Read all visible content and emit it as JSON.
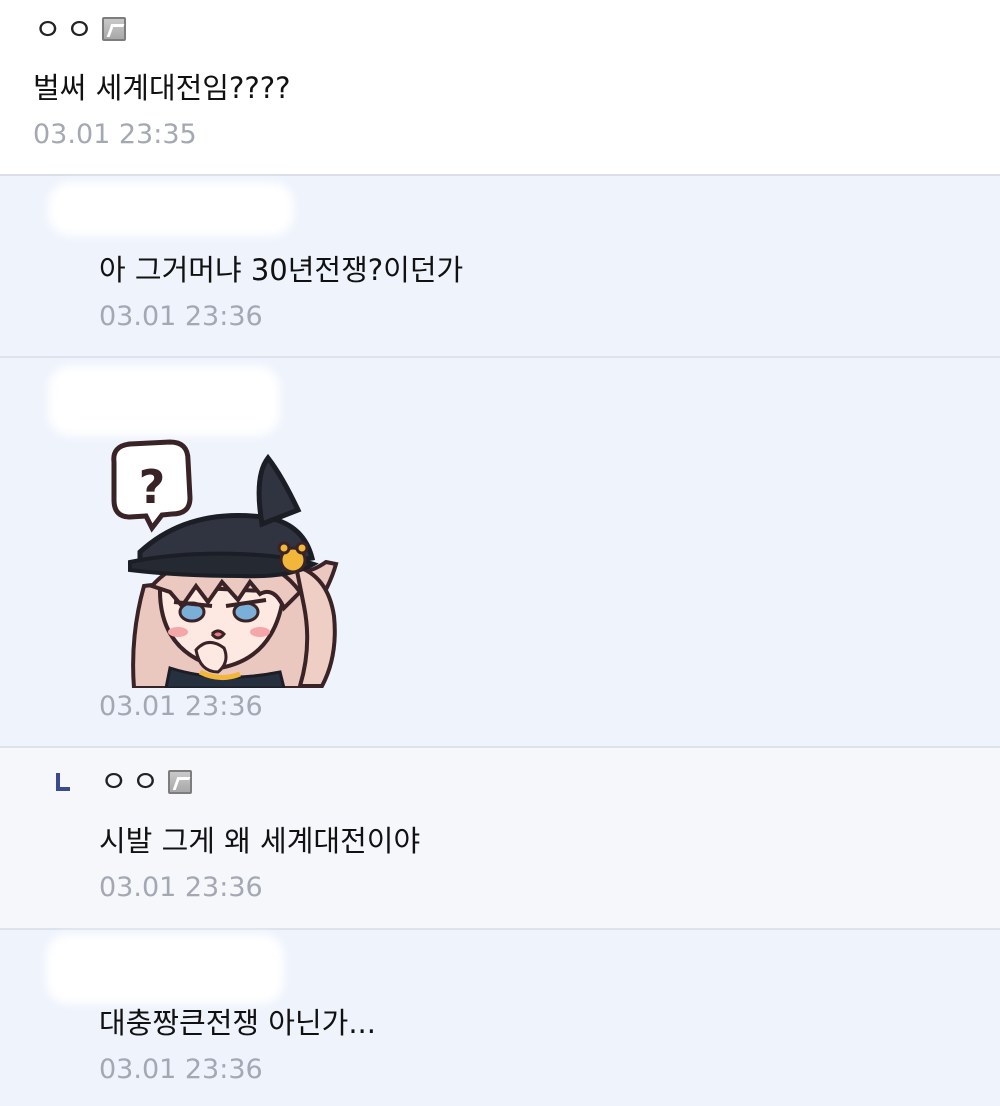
{
  "comments": [
    {
      "author": "ㅇㅇ",
      "text": "벌써 세계대전임????",
      "time": "03.01 23:35"
    },
    {
      "text": "아 그거머냐 30년전쟁?이던가",
      "time": "03.01 23:36"
    },
    {
      "sticker_icon": "anime-girl-question-sticker",
      "sticker_bubble": "?",
      "time": "03.01 23:36"
    },
    {
      "author": "ㅇㅇ",
      "text": "시발 그게 왜 세계대전이야",
      "time": "03.01 23:36"
    },
    {
      "text": "대충짱큰전쟁 아닌가...",
      "time": "03.01 23:36"
    }
  ],
  "colors": {
    "reply_bg": "#eef3fc",
    "timestamp": "#a3a8b2",
    "reply_mark": "#3a4a8c"
  }
}
